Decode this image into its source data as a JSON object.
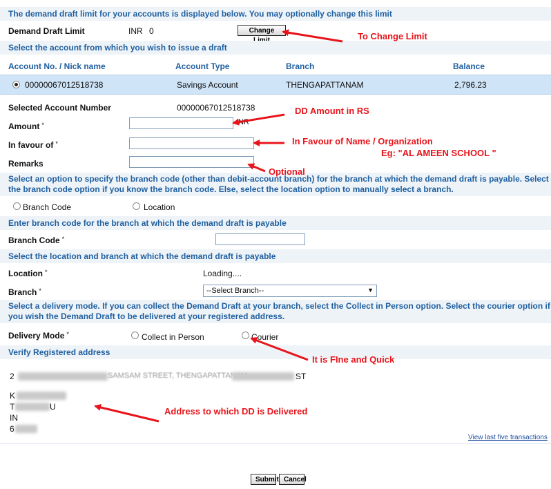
{
  "intro_text": "The demand draft limit for your accounts is displayed below. You may optionally change this limit",
  "dd_limit": {
    "label": "Demand Draft Limit",
    "currency": "INR",
    "value": "0",
    "button": "Change Limit"
  },
  "select_account_text": "Select the account from which you wish to issue a draft",
  "accounts_table": {
    "headers": [
      "Account No. / Nick name",
      "Account Type",
      "Branch",
      "Balance"
    ],
    "rows": [
      {
        "account_no": "00000067012518738",
        "type": "Savings Account",
        "branch": "THENGAPATTANAM",
        "balance": "2,796.23"
      }
    ]
  },
  "form": {
    "selected_account_label": "Selected Account Number",
    "selected_account_value": "00000067012518738",
    "amount_label": "Amount",
    "amount_suffix": "INR",
    "favour_label": "In favour of",
    "remarks_label": "Remarks",
    "required_mark": "*"
  },
  "branch_option_text": "Select an option to specify the branch code (other than debit-account branch) for the branch at which the demand draft is payable. Select the branch code option if you know the branch code. Else, select the location option to manually select a branch.",
  "branch_options": [
    "Branch Code",
    "Location"
  ],
  "branch_code_section": {
    "heading": "Enter branch code for the branch at which the demand draft is payable",
    "label": "Branch Code"
  },
  "location_section": {
    "heading": "Select the location and branch at which the demand draft is payable",
    "location_label": "Location",
    "location_value": "Loading....",
    "branch_label": "Branch",
    "branch_select": "--Select Branch--"
  },
  "delivery": {
    "text": "Select a delivery mode. If you can collect the Demand Draft at your branch, select the Collect in Person option. Select the courier option if you wish the Demand Draft to be delivered at your registered address.",
    "label": "Delivery Mode",
    "options": [
      "Collect in Person",
      "Courier"
    ]
  },
  "address": {
    "heading": "Verify Registered address",
    "line1_visible": "SAMSAM STREET, THENGAPATTANAM",
    "line1_end": "ST",
    "line_prefixes": [
      "K",
      "T",
      "IN",
      "6"
    ],
    "line_suffixes": [
      "",
      "U",
      "",
      ""
    ]
  },
  "view_last": "View last five transactions",
  "buttons": {
    "submit": "Submit",
    "cancel": "Cancel"
  },
  "annotations": {
    "change_limit": "To Change Limit",
    "dd_amount": "DD Amount in RS",
    "favour_line1": "In Favour of Name / Organization",
    "favour_line2": "Eg: \"AL AMEEN SCHOOL \"",
    "optional": "Optional",
    "courier": "It is FIne and Quick",
    "address": "Address to which DD is Delivered"
  },
  "colors": {
    "band_bg": "#eef3f8",
    "band_text": "#1f5f9f",
    "selected_row_bg": "#cfe4f7",
    "annotation": "#e8141b",
    "link": "#2050a0"
  }
}
